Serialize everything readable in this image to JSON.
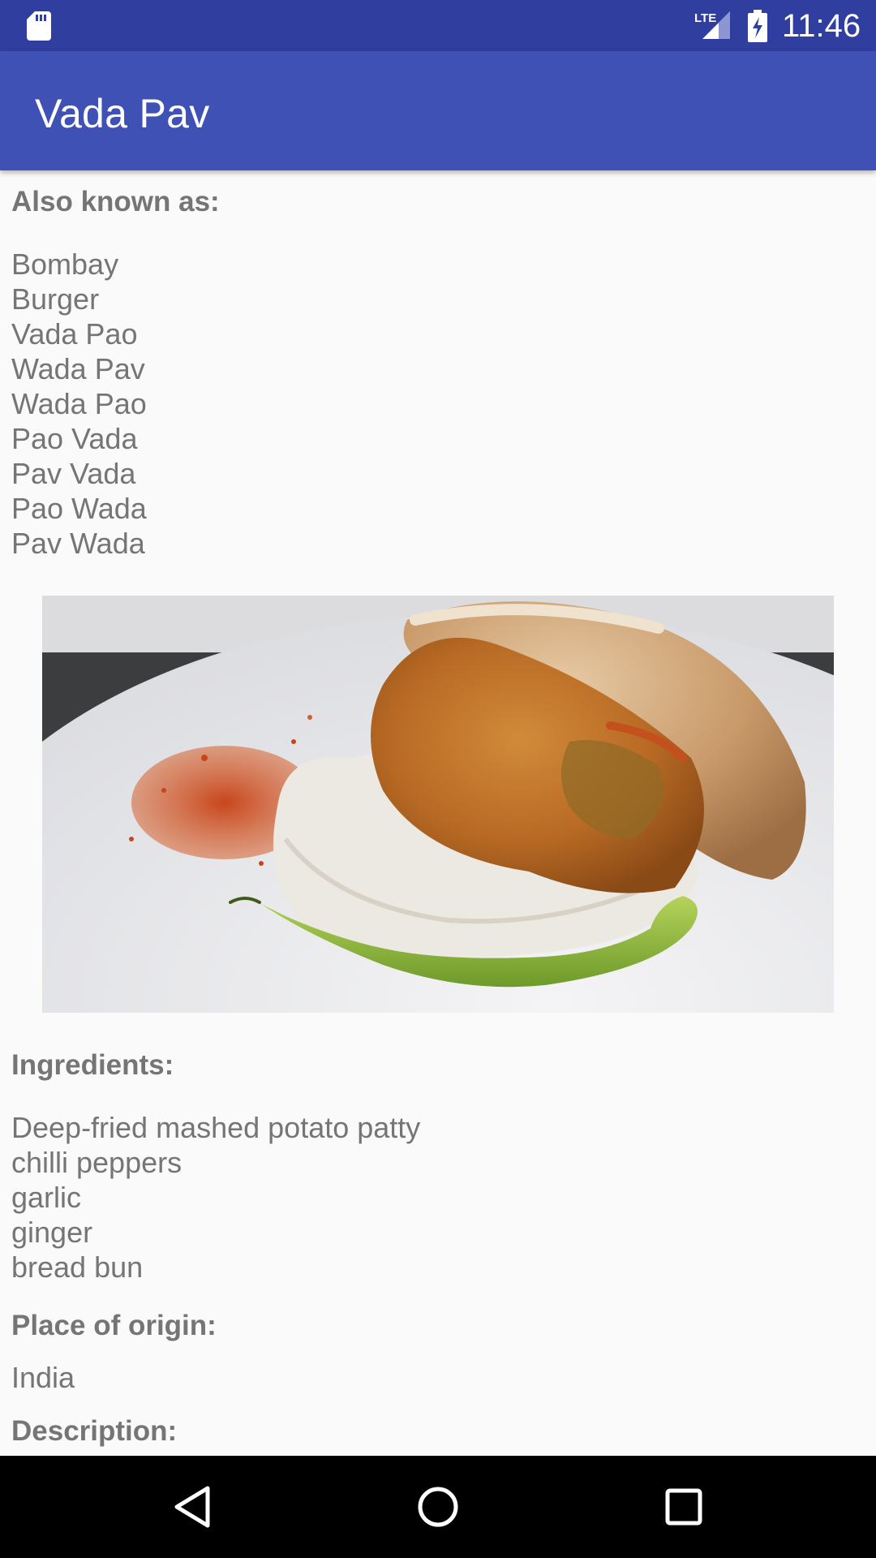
{
  "status_bar": {
    "time": "11:46",
    "network": "LTE",
    "icons": [
      "sd-card-icon",
      "signal-icon",
      "battery-charging-icon"
    ]
  },
  "app_bar": {
    "title": "Vada Pav"
  },
  "sections": {
    "also_known_as": {
      "heading": "Also known as:",
      "items": [
        "Bombay",
        "Burger",
        "Vada Pao",
        "Wada Pav",
        "Wada Pao",
        "Pao Vada",
        "Pav Vada",
        "Pao Wada",
        "Pav Wada"
      ]
    },
    "ingredients": {
      "heading": "Ingredients:",
      "items": [
        "Deep-fried mashed potato patty",
        "chilli peppers",
        "garlic",
        "ginger",
        "bread bun"
      ]
    },
    "place_of_origin": {
      "heading": "Place of origin:",
      "value": "India"
    },
    "description": {
      "heading": "Description:"
    }
  },
  "navigation": {
    "icons": [
      "back-icon",
      "home-icon",
      "recents-icon"
    ]
  },
  "colors": {
    "status_bar": "#303f9f",
    "app_bar": "#3f51b5",
    "text": "#757575",
    "background": "#fafafa"
  }
}
